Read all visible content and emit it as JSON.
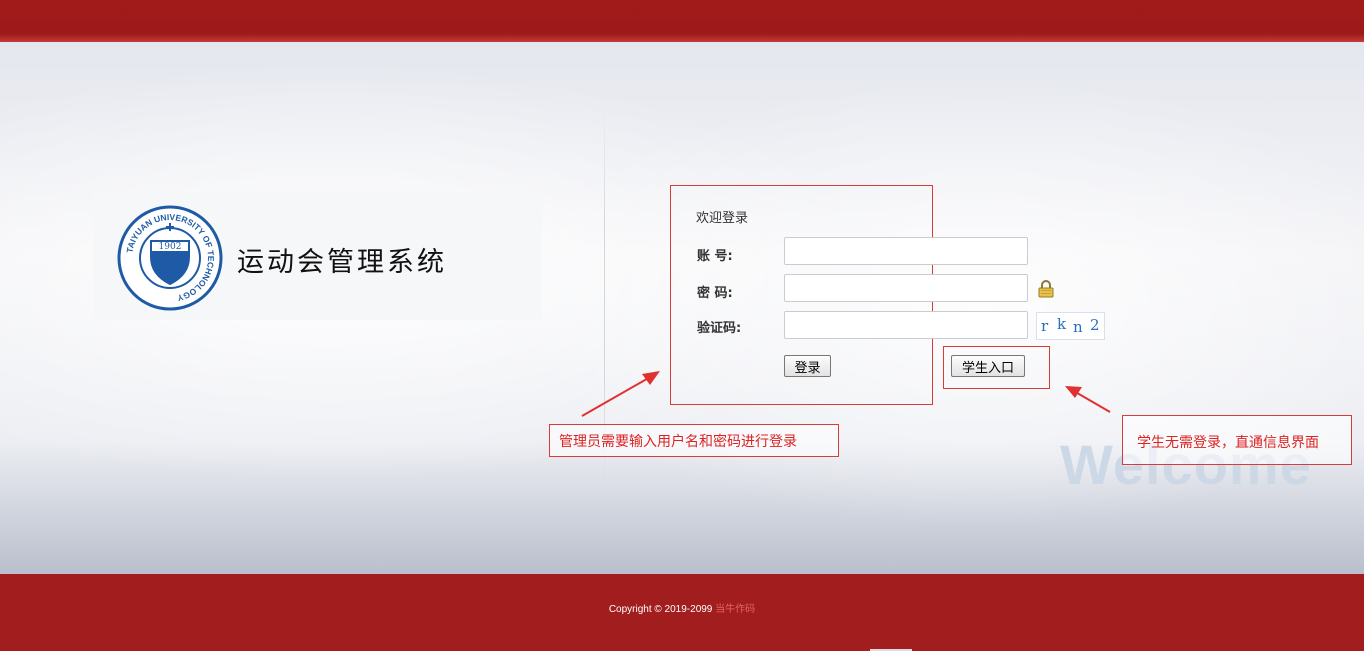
{
  "header": {},
  "branding": {
    "system_title": "运动会管理系统",
    "emblem_year": "1902",
    "emblem_ring_text": "TAIYUAN UNIVERSITY OF TECHNOLOGY"
  },
  "login": {
    "welcome": "欢迎登录",
    "account_label": "账 号:",
    "account_value": "",
    "password_label": "密 码:",
    "password_value": "",
    "captcha_label": "验证码:",
    "captcha_value": "",
    "captcha_chars": [
      "r",
      "k",
      "n",
      "2"
    ],
    "login_button": "登录",
    "student_button": "学生入口"
  },
  "annotations": {
    "admin_note": "管理员需要输入用户名和密码进行登录",
    "student_note": "学生无需登录，直通信息界面"
  },
  "watermark": "Welcome",
  "footer": {
    "copyright": "Copyright © 2019-2099",
    "brand": "当牛作码"
  },
  "colors": {
    "brand_red": "#a21e1e",
    "annotation_red": "#d93b3b",
    "captcha_blue": "#2a6fbd"
  },
  "icons": [
    "lock-icon",
    "university-emblem",
    "arrow-icon"
  ]
}
